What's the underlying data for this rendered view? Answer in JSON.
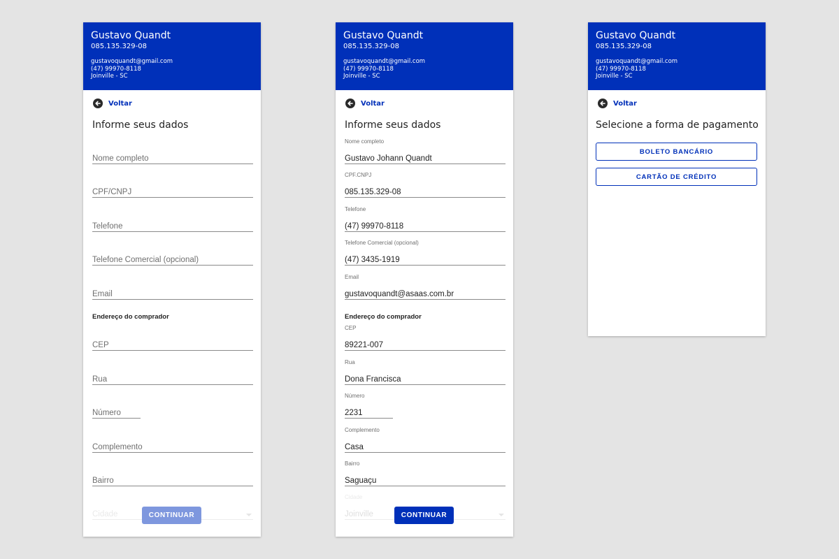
{
  "header": {
    "name": "Gustavo Quandt",
    "document": "085.135.329-08",
    "email": "gustavoquandt@gmail.com",
    "phone": "(47) 99970-8118",
    "city": "Joinville - SC"
  },
  "nav": {
    "back_label": "Voltar"
  },
  "form": {
    "title": "Informe seus dados",
    "address_section": "Endereço do comprador",
    "continue_label": "CONTINUAR",
    "empty": {
      "nome": "Nome completo",
      "cpf": "CPF/CNPJ",
      "telefone": "Telefone",
      "telefone_comercial": "Telefone Comercial (opcional)",
      "email": "Email",
      "cep": "CEP",
      "rua": "Rua",
      "numero": "Número",
      "complemento": "Complemento",
      "bairro": "Bairro",
      "cidade": "Cidade"
    },
    "filled": {
      "nome": {
        "label": "Nome completo",
        "value": "Gustavo Johann Quandt"
      },
      "cpf": {
        "label": "CPF.CNPJ",
        "value": "085.135.329-08"
      },
      "telefone": {
        "label": "Telefone",
        "value": "(47) 99970-8118"
      },
      "telefone_comercial": {
        "label": "Telefone Comercial (opcional)",
        "value": "(47) 3435-1919"
      },
      "email": {
        "label": "Email",
        "value": "gustavoquandt@asaas.com.br"
      },
      "cep": {
        "label": "CEP",
        "value": "89221-007"
      },
      "rua": {
        "label": "Rua",
        "value": "Dona Francisca"
      },
      "numero": {
        "label": "Número",
        "value": "2231"
      },
      "complemento": {
        "label": "Complemento",
        "value": "Casa"
      },
      "bairro": {
        "label": "Bairro",
        "value": "Saguaçu"
      },
      "cidade": {
        "label": "Cidade",
        "value": "Joinville"
      }
    }
  },
  "payment": {
    "title": "Selecione a forma de pagamento",
    "boleto_label": "BOLETO BANCÁRIO",
    "cartao_label": "CARTÃO DE CRÉDITO"
  },
  "colors": {
    "brand": "#0030b9",
    "brand_disabled": "#7e97de",
    "background": "#e4e4e4"
  }
}
